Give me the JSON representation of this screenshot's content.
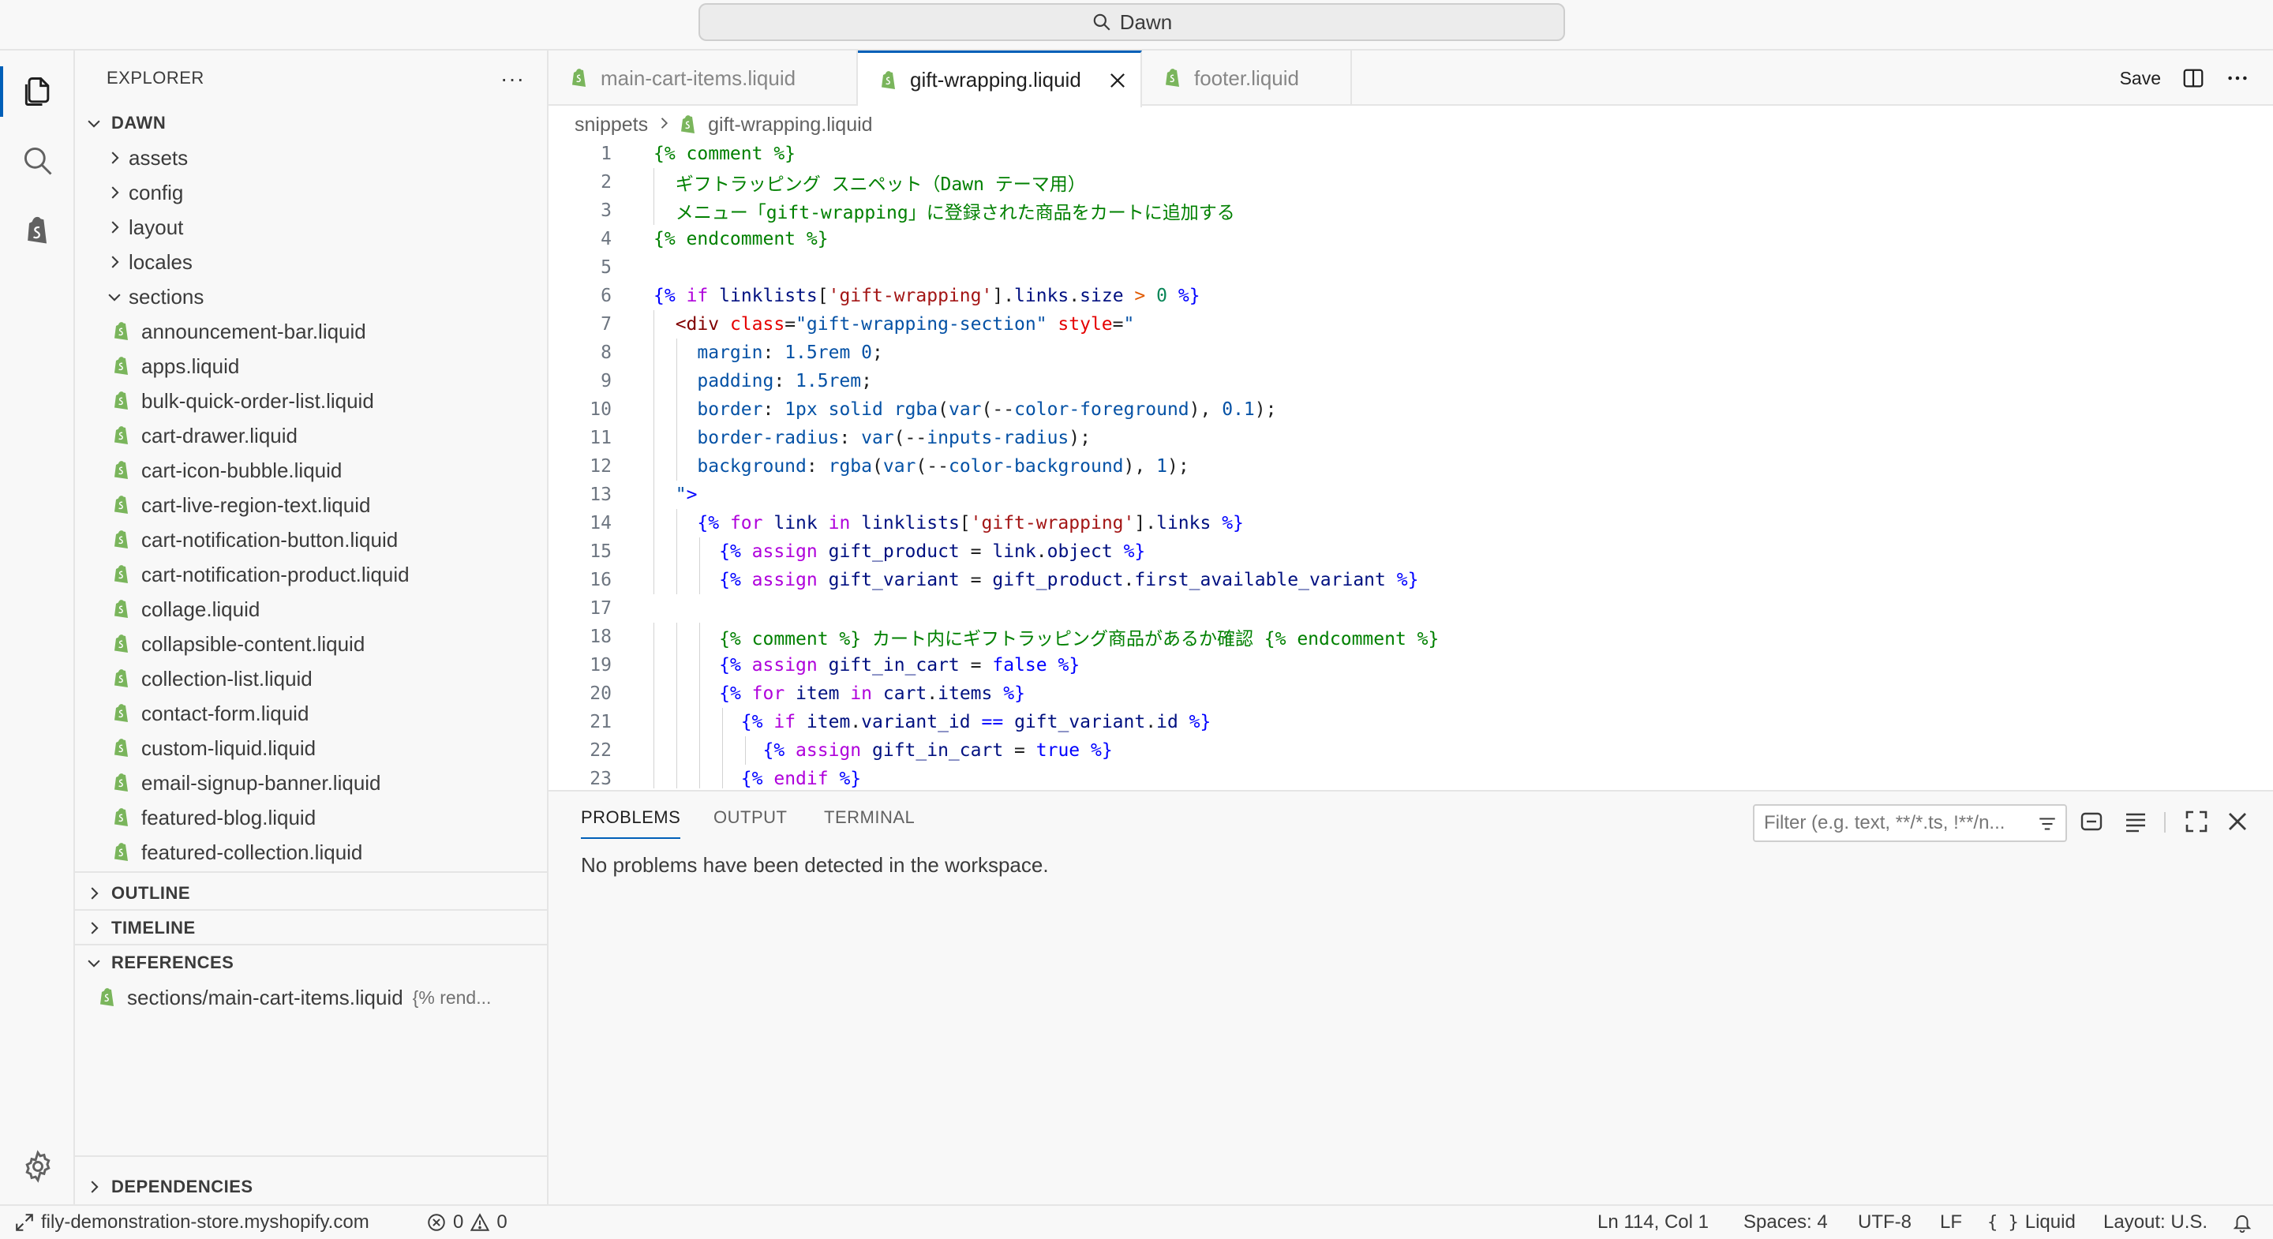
{
  "window": {
    "search_text": "Dawn"
  },
  "activity_bar": {
    "items": [
      "explorer-icon",
      "search-icon",
      "shopify-icon"
    ],
    "bottom": "settings-gear-icon"
  },
  "explorer": {
    "title": "EXPLORER",
    "more": "···",
    "root": "DAWN",
    "folders": [
      "assets",
      "config",
      "layout",
      "locales",
      "sections"
    ],
    "section_files": [
      "announcement-bar.liquid",
      "apps.liquid",
      "bulk-quick-order-list.liquid",
      "cart-drawer.liquid",
      "cart-icon-bubble.liquid",
      "cart-live-region-text.liquid",
      "cart-notification-button.liquid",
      "cart-notification-product.liquid",
      "collage.liquid",
      "collapsible-content.liquid",
      "collection-list.liquid",
      "contact-form.liquid",
      "custom-liquid.liquid",
      "email-signup-banner.liquid",
      "featured-blog.liquid",
      "featured-collection.liquid"
    ],
    "outline": "OUTLINE",
    "timeline": "TIMELINE",
    "references": "REFERENCES",
    "reference_item": {
      "path": "sections/main-cart-items.liquid",
      "snippet": "{% rend..."
    },
    "dependencies": "DEPENDENCIES"
  },
  "tabs": [
    {
      "label": "main-cart-items.liquid",
      "active": false
    },
    {
      "label": "gift-wrapping.liquid",
      "active": true
    },
    {
      "label": "footer.liquid",
      "active": false
    }
  ],
  "editor_actions": {
    "save": "Save"
  },
  "breadcrumb": {
    "folder": "snippets",
    "file": "gift-wrapping.liquid"
  },
  "code_lines": [
    "{% comment %}",
    "  ギフトラッピング スニペット（Dawn テーマ用）",
    "  メニュー「gift-wrapping」に登録された商品をカートに追加する",
    "{% endcomment %}",
    "",
    "{% if linklists['gift-wrapping'].links.size > 0 %}",
    "  <div class=\"gift-wrapping-section\" style=\"",
    "    margin: 1.5rem 0;",
    "    padding: 1.5rem;",
    "    border: 1px solid rgba(var(--color-foreground), 0.1);",
    "    border-radius: var(--inputs-radius);",
    "    background: rgba(var(--color-background), 1);",
    "  \">",
    "    {% for link in linklists['gift-wrapping'].links %}",
    "      {% assign gift_product = link.object %}",
    "      {% assign gift_variant = gift_product.first_available_variant %}",
    "",
    "      {% comment %} カート内にギフトラッピング商品があるか確認 {% endcomment %}",
    "      {% assign gift_in_cart = false %}",
    "      {% for item in cart.items %}",
    "        {% if item.variant_id == gift_variant.id %}",
    "          {% assign gift_in_cart = true %}",
    "        {% endif %}"
  ],
  "panel": {
    "tabs": [
      "PROBLEMS",
      "OUTPUT",
      "TERMINAL"
    ],
    "filter_placeholder": "Filter (e.g. text, **/*.ts, !**/n...",
    "message": "No problems have been detected in the workspace."
  },
  "status_bar": {
    "remote": "fily-demonstration-store.myshopify.com",
    "errors": "0",
    "warnings": "0",
    "position": "Ln 114, Col 1",
    "spaces": "Spaces: 4",
    "encoding": "UTF-8",
    "eol": "LF",
    "language": "Liquid",
    "layout": "Layout: U.S."
  },
  "colors": {
    "accent": "#005fb8",
    "liquid_icon": "#7ab55c"
  }
}
